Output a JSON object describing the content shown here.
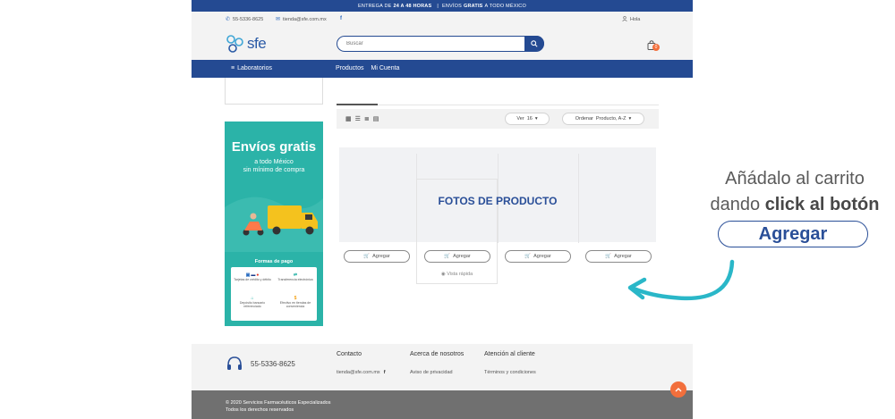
{
  "promo_bar": {
    "part1": "ENTREGA DE",
    "bold1": "24 A 48 HORAS",
    "sep": "|",
    "part2": "ENVÍOS",
    "bold2": "GRATIS",
    "part3": "A TODO MÉXICO"
  },
  "top_bar": {
    "phone": "55-5336-8625",
    "email": "tienda@sfe.com.mx",
    "greeting": "Hola"
  },
  "header": {
    "logo_text": "sfe",
    "search_placeholder": "Buscar",
    "cart_count": "0"
  },
  "nav": {
    "category_label": "Laboratorios",
    "links": [
      "Productos",
      "Mi Cuenta"
    ]
  },
  "banner": {
    "title": "Envíos gratis",
    "subtitle_line1": "a todo México",
    "subtitle_line2": "sin mínimo de compra",
    "payments_title": "Formas de pago",
    "pay1": "Tarjetas de crédito y débito",
    "pay2": "Transferencia electrónica",
    "pay3": "Depósito bancario referenciado",
    "pay4": "Efectivo en tiendas de conveniencia"
  },
  "toolbar": {
    "view_label": "Ver",
    "view_count": "16",
    "sort_label": "Ordenar",
    "sort_value": "Producto, A-Z"
  },
  "products": {
    "photos_label": "FOTOS DE PRODUCTO",
    "add_label": "Agregar",
    "quick_view": "Vista rápida"
  },
  "footer": {
    "phone": "55-5336-8625",
    "col1_title": "Contacto",
    "col1_link": "tienda@sfe.com.mx",
    "col2_title": "Acerca de nosotros",
    "col2_link": "Aviso de privacidad",
    "col3_title": "Atención al cliente",
    "col3_link": "Términos y condiciones",
    "copyright": "© 2020 Servicios Farmacéuticos Especializados",
    "rights": "Todos los derechos reservados"
  },
  "annotation": {
    "line1": "Añádalo al carrito",
    "line2_plain": "dando",
    "line2_bold": "click al botón",
    "button": "Agregar"
  },
  "colors": {
    "brand_blue": "#244a92",
    "accent_orange": "#f26f3c",
    "teal": "#2bb3a8",
    "arrow": "#2ab7c8"
  }
}
